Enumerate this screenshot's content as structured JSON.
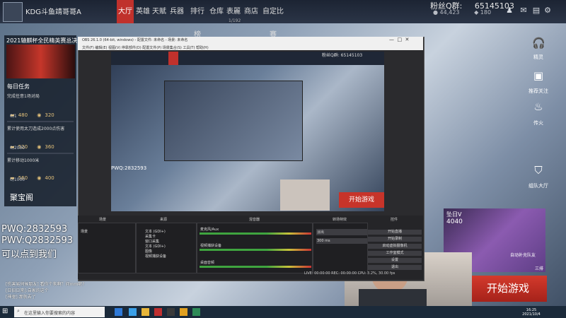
{
  "game": {
    "player_name": "KDG斗鱼靖哥哥A",
    "nav": [
      "大厅",
      "英雄",
      "天赋",
      "兵器",
      "排行榜",
      "仓库",
      "表麗",
      "商店",
      "自定比赛"
    ],
    "fans_label": "粉丝Q群:",
    "fans_value": "65145103",
    "fans_sub_a": "44,423",
    "fans_sub_b": "180",
    "page_indicator": "1/192"
  },
  "left": {
    "event_title": "2021辕麒杯全民精英赛总决",
    "daily_title": "每日任务",
    "tasks": [
      {
        "text": "完成任意1场对局",
        "r1": "480",
        "r2": "320",
        "progress": "0/1"
      },
      {
        "text": "累计使用太刀造成2000点伤害",
        "r1": "520",
        "r2": "360",
        "progress": "0/2000"
      },
      {
        "text": "累计移动1000米",
        "r1": "560",
        "r2": "400",
        "progress": "0/1000"
      }
    ],
    "treasure": "聚宝阁"
  },
  "overlay": {
    "line1": "PWQ:2832593",
    "line2": "PWV:Q2832593",
    "line3": "可以点到我们"
  },
  "chat": [
    "[伤害易伺候朋友] 看你个狗啊？问mm呢?",
    "[日旧日常]:自家的这个",
    "[神驱]:那就去了"
  ],
  "right": {
    "items": [
      "精灵",
      "推荐关注",
      "传火",
      "组队大厅"
    ],
    "rank_label": "坠日V",
    "rank_value": "4040",
    "auto_match": "自动补充队友",
    "three_row": "三排",
    "start_game": "开始游戏"
  },
  "obs": {
    "title": "OBS 26.1.0 (64-bit, windows) - 配置文件: 未命名 - 场景: 未命名",
    "menu": "文件(F)  编辑(E)  视图(V)  停靠部件(D)  配置文件(P)  场景集合(S)  工具(T)  帮助(H)",
    "inner_fans": "粉丝Q群: 65145103",
    "inner_start": "开始游戏",
    "inner_overlay": "PWQ:2832593",
    "docks": [
      "场景",
      "来源",
      "混音器",
      "转场特效",
      "控件"
    ],
    "scene": "场景",
    "sources": [
      "文本 (GDI+)",
      "采集卡",
      "窗口采集",
      "文本 (GDI+)",
      "图像",
      "视频捕获设备"
    ],
    "controls": [
      "开始直播",
      "开始录制",
      "启动虚拟摄像机",
      "工作室模式",
      "设置",
      "退出"
    ],
    "mixer": [
      "麦克风/Aux",
      "视频捕获设备",
      "桌面音频"
    ],
    "transition": "淡出",
    "duration": "300 ms",
    "status": "LIVE: 00:00:00   REC: 00:00:00   CPU: 3.2%, 30.00 fps"
  },
  "taskbar": {
    "search_placeholder": "在这里输入你要搜索的内容",
    "time": "16:25",
    "date": "2021/10/4"
  },
  "colors": {
    "accent": "#c0312c",
    "topbar": "#1c2433",
    "obs_bg": "#2b2b2e"
  }
}
